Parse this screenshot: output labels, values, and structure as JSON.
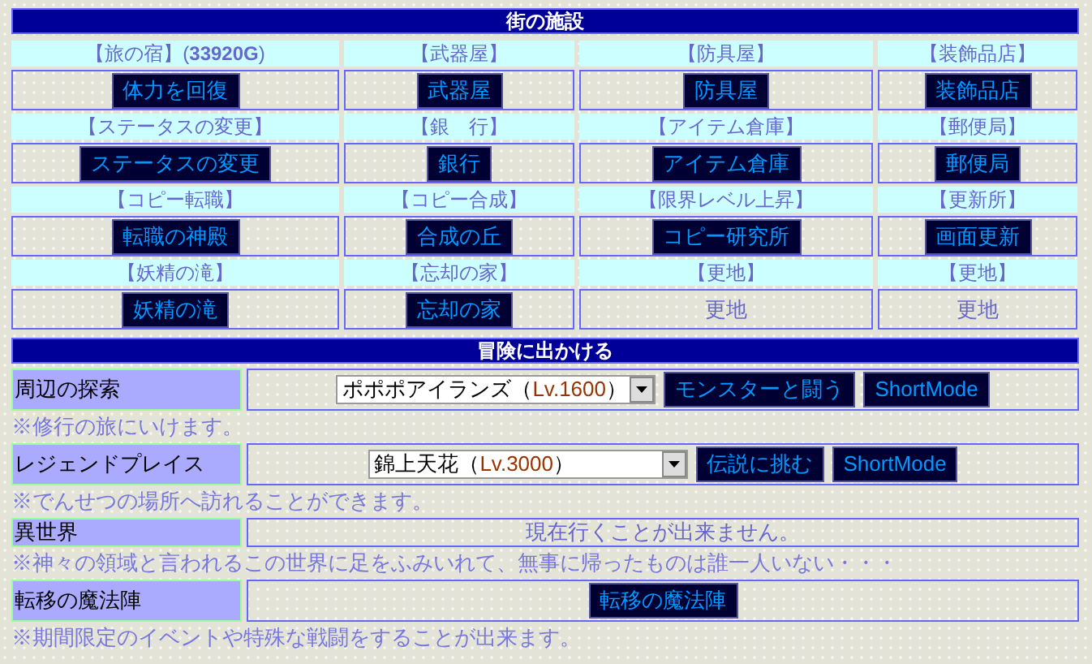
{
  "town": {
    "title": "街の施設",
    "facilities": [
      {
        "label": "【旅の宿】(**33920G**)",
        "kind": "button",
        "action": "体力を回復"
      },
      {
        "label": "【武器屋】",
        "kind": "button",
        "action": "武器屋"
      },
      {
        "label": "【防具屋】",
        "kind": "button",
        "action": "防具屋"
      },
      {
        "label": "【装飾品店】",
        "kind": "button",
        "action": "装飾品店"
      },
      {
        "label": "【ステータスの変更】",
        "kind": "button",
        "action": "ステータスの変更"
      },
      {
        "label": "【銀　行】",
        "kind": "button",
        "action": "銀行"
      },
      {
        "label": "【アイテム倉庫】",
        "kind": "button",
        "action": "アイテム倉庫"
      },
      {
        "label": "【郵便局】",
        "kind": "button",
        "action": "郵便局"
      },
      {
        "label": "【コピー転職】",
        "kind": "button",
        "action": "転職の神殿"
      },
      {
        "label": "【コピー合成】",
        "kind": "button",
        "action": "合成の丘"
      },
      {
        "label": "【限界レベル上昇】",
        "kind": "button",
        "action": "コピー研究所"
      },
      {
        "label": "【更新所】",
        "kind": "button",
        "action": "画面更新"
      },
      {
        "label": "【妖精の滝】",
        "kind": "button",
        "action": "妖精の滝"
      },
      {
        "label": "【忘却の家】",
        "kind": "button",
        "action": "忘却の家"
      },
      {
        "label": "【更地】",
        "kind": "text",
        "action": "更地"
      },
      {
        "label": "【更地】",
        "kind": "text",
        "action": "更地"
      }
    ]
  },
  "adventure": {
    "title": "冒険に出かける",
    "rows": [
      {
        "label": "周辺の探索",
        "kind": "select",
        "area": "ポポポアイランズ（",
        "lv": "Lv.1600",
        "close": "）",
        "buttons": [
          "モンスターと闘う",
          "ShortMode"
        ],
        "note": "※修行の旅にいけます。"
      },
      {
        "label": "レジェンドプレイス",
        "kind": "select",
        "area": "錦上天花（",
        "lv": "Lv.3000",
        "close": "）",
        "buttons": [
          "伝説に挑む",
          "ShortMode"
        ],
        "note": "※でんせつの場所へ訪れることができます。"
      },
      {
        "label": "異世界",
        "kind": "text",
        "message": "現在行くことが出来ません。",
        "note": "※神々の領域と言われるこの世界に足をふみいれて、無事に帰ったものは誰一人いない・・・"
      },
      {
        "label": "転移の魔法陣",
        "kind": "button",
        "buttons": [
          "転移の魔法陣"
        ],
        "note": "※期間限定のイベントや特殊な戦闘をすることが出来ます。"
      }
    ]
  }
}
